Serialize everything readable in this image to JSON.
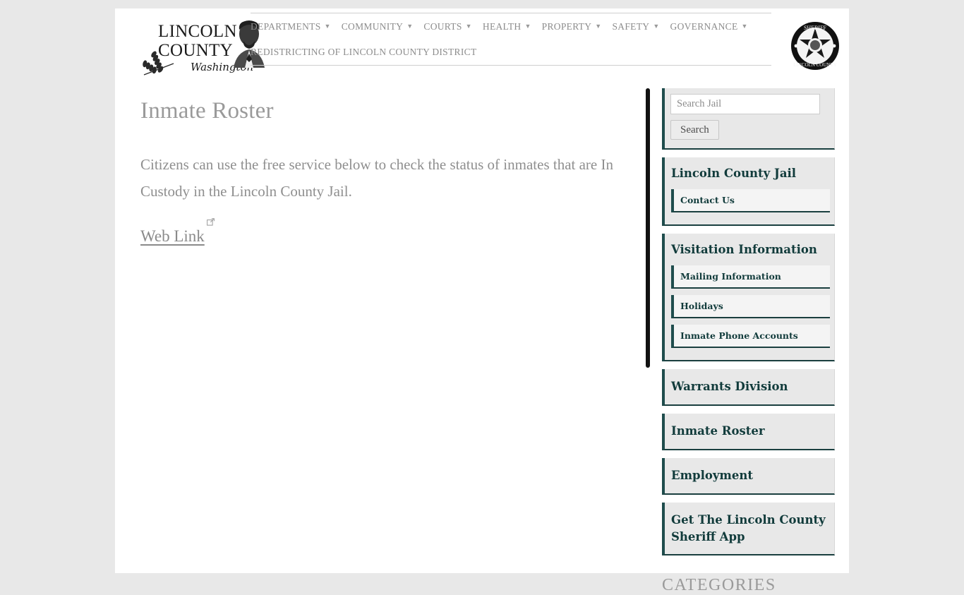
{
  "site": {
    "logo_line1": "LINCOLN",
    "logo_line2": "COUNTY",
    "logo_line3": "Washington",
    "badge_alt": "sheriff-badge-seal"
  },
  "nav": {
    "primary": [
      {
        "label": "DEPARTMENTS",
        "caret": "⌄"
      },
      {
        "label": "COMMUNITY",
        "caret": "⌄"
      },
      {
        "label": "COURTS",
        "caret": "⌄"
      },
      {
        "label": "HEALTH",
        "caret": "⌄"
      },
      {
        "label": "PROPERTY",
        "caret": "⌄"
      },
      {
        "label": "SAFETY",
        "caret": "⌄"
      },
      {
        "label": "GOVERNANCE",
        "caret": "⌄"
      }
    ],
    "secondary": [
      {
        "label": "REDISTRICTING OF LINCOLN COUNTY DISTRICT"
      }
    ]
  },
  "main": {
    "title": "Inmate Roster",
    "paragraph": "Citizens can use the free service below to check the status of inmates that are In Custody in the Lincoln County Jail.",
    "web_link_label": "Web Link",
    "external_icon": "external-link-icon"
  },
  "sidebar": {
    "search": {
      "placeholder": "Search Jail",
      "value": "",
      "button_label": "Search"
    },
    "menus": [
      {
        "title": "Lincoln County Jail",
        "children": [
          {
            "label": "Contact Us"
          }
        ]
      },
      {
        "title": "Visitation Information",
        "children": [
          {
            "label": "Mailing Information"
          },
          {
            "label": "Holidays"
          },
          {
            "label": "Inmate Phone Accounts"
          }
        ]
      },
      {
        "title": "Warrants Division",
        "children": []
      },
      {
        "title": "Inmate Roster",
        "children": []
      },
      {
        "title": "Employment",
        "children": []
      },
      {
        "title": "Get The Lincoln County Sheriff App",
        "children": []
      }
    ],
    "categories_heading": "CATEGORIES"
  },
  "colors": {
    "page_background": "#e8e8e8",
    "content_background": "#ffffff",
    "accent_teal": "#1f4d4d",
    "menu_text": "#113b3b",
    "muted_text": "#8f8f8f",
    "scrollbar": "#111111"
  }
}
